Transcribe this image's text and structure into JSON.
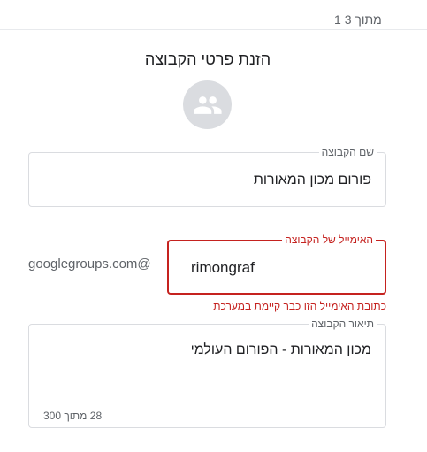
{
  "step": {
    "indicator": "1 מתוך 3"
  },
  "title": "הזנת פרטי הקבוצה",
  "avatar": {
    "icon": "group-icon"
  },
  "group_name": {
    "label": "שם הקבוצה",
    "value": "פורום מכון המאורות"
  },
  "group_email": {
    "label": "האימייל של הקבוצה",
    "value": "rimongraf",
    "suffix": "googlegroups.com@",
    "error": "כתובת האימייל הזו כבר קיימת במערכת",
    "error_color": "#c5221f"
  },
  "group_description": {
    "label": "תיאור הקבוצה",
    "value": "מכון המאורות - הפורום העולמי",
    "counter": "28 מתוך 300"
  }
}
